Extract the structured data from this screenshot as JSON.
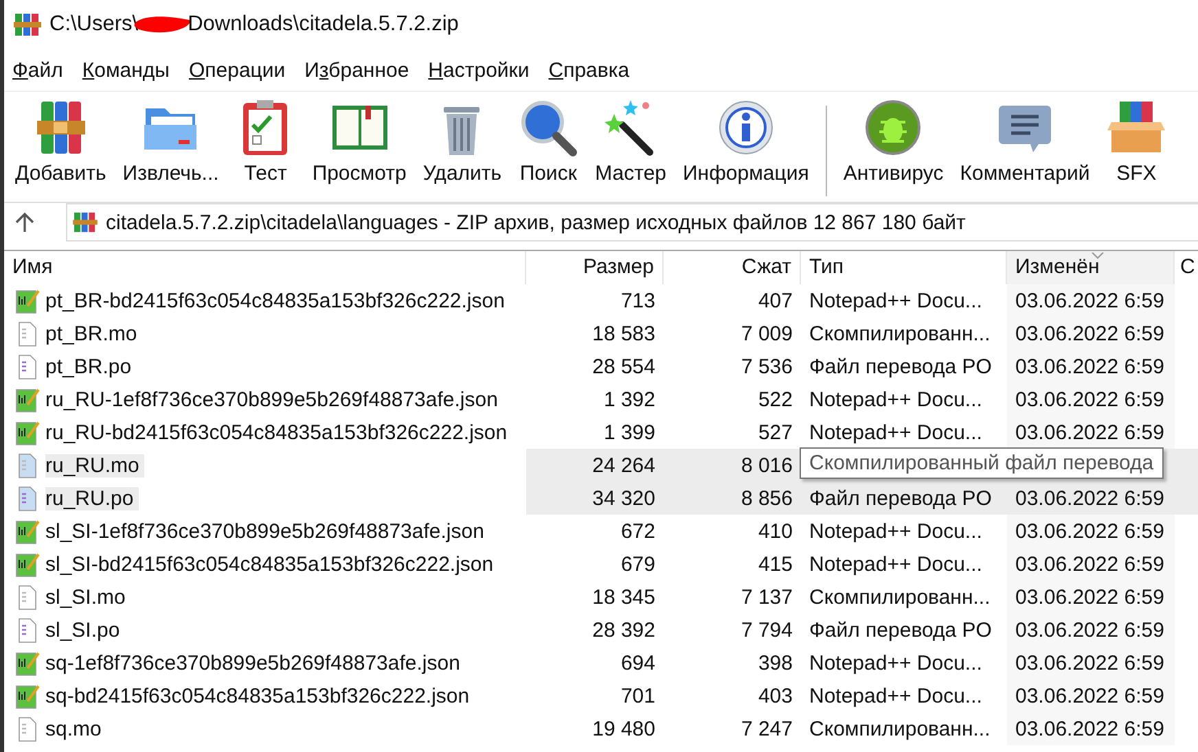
{
  "window": {
    "title_start": "C:\\Users\\",
    "title_end": "Downloads\\citadela.5.7.2.zip"
  },
  "menu": [
    {
      "key": "Ф",
      "rest": "айл"
    },
    {
      "key": "К",
      "rest": "оманды"
    },
    {
      "key": "О",
      "rest": "перации"
    },
    {
      "lead": "И",
      "key": "з",
      "rest": "бранное"
    },
    {
      "key": "Н",
      "rest": "астройки"
    },
    {
      "key": "С",
      "rest": "правка"
    }
  ],
  "toolbar": [
    {
      "label": "Добавить",
      "kind": "add"
    },
    {
      "label": "Извлечь...",
      "kind": "extract"
    },
    {
      "label": "Тест",
      "kind": "test"
    },
    {
      "label": "Просмотр",
      "kind": "view"
    },
    {
      "label": "Удалить",
      "kind": "delete"
    },
    {
      "label": "Поиск",
      "kind": "find"
    },
    {
      "label": "Мастер",
      "kind": "wizard"
    },
    {
      "label": "Информация",
      "kind": "info"
    },
    {
      "label": "Антивирус",
      "kind": "virus",
      "separator_before": true
    },
    {
      "label": "Комментарий",
      "kind": "comment"
    },
    {
      "label": "SFX",
      "kind": "sfx"
    }
  ],
  "address": {
    "value": "citadela.5.7.2.zip\\citadela\\languages - ZIP архив, размер исходных файлов 12 867 180 байт"
  },
  "table": {
    "columns": [
      {
        "label": "Имя",
        "sorted": false
      },
      {
        "label": "Размер",
        "sorted": false
      },
      {
        "label": "Сжат",
        "sorted": false
      },
      {
        "label": "Тип",
        "sorted": false
      },
      {
        "label": "Изменён",
        "sorted": true
      },
      {
        "label": "С",
        "sorted": false
      }
    ],
    "rows": [
      {
        "kind": "json",
        "selected": false,
        "name": "pt_BR-bd2415f63c054c84835a153bf326c222.json",
        "size": "713",
        "packed": "407",
        "type": "Notepad++ Docu...",
        "modified": "03.06.2022 6:59"
      },
      {
        "kind": "mo",
        "selected": false,
        "name": "pt_BR.mo",
        "size": "18 583",
        "packed": "7 009",
        "type": "Скомпилированн...",
        "modified": "03.06.2022 6:59"
      },
      {
        "kind": "po",
        "selected": false,
        "name": "pt_BR.po",
        "size": "28 554",
        "packed": "7 536",
        "type": "Файл перевода PO",
        "modified": "03.06.2022 6:59"
      },
      {
        "kind": "json",
        "selected": false,
        "name": "ru_RU-1ef8f736ce370b899e5b269f48873afe.json",
        "size": "1 392",
        "packed": "522",
        "type": "Notepad++ Docu...",
        "modified": "03.06.2022 6:59"
      },
      {
        "kind": "json",
        "selected": false,
        "name": "ru_RU-bd2415f63c054c84835a153bf326c222.json",
        "size": "1 399",
        "packed": "527",
        "type": "Notepad++ Docu...",
        "modified": "03.06.2022 6:59"
      },
      {
        "kind": "mo",
        "selected": true,
        "name": "ru_RU.mo",
        "size": "24 264",
        "packed": "8 016"
      },
      {
        "kind": "po",
        "selected": true,
        "name": "ru_RU.po",
        "size": "34 320",
        "packed": "8 856",
        "type": "Файл перевода PO",
        "modified": "03.06.2022 6:59"
      },
      {
        "kind": "json",
        "selected": false,
        "name": "sl_SI-1ef8f736ce370b899e5b269f48873afe.json",
        "size": "672",
        "packed": "410",
        "type": "Notepad++ Docu...",
        "modified": "03.06.2022 6:59"
      },
      {
        "kind": "json",
        "selected": false,
        "name": "sl_SI-bd2415f63c054c84835a153bf326c222.json",
        "size": "679",
        "packed": "415",
        "type": "Notepad++ Docu...",
        "modified": "03.06.2022 6:59"
      },
      {
        "kind": "mo",
        "selected": false,
        "name": "sl_SI.mo",
        "size": "18 345",
        "packed": "7 137",
        "type": "Скомпилированн...",
        "modified": "03.06.2022 6:59"
      },
      {
        "kind": "po",
        "selected": false,
        "name": "sl_SI.po",
        "size": "28 392",
        "packed": "7 794",
        "type": "Файл перевода PO",
        "modified": "03.06.2022 6:59"
      },
      {
        "kind": "json",
        "selected": false,
        "name": "sq-1ef8f736ce370b899e5b269f48873afe.json",
        "size": "694",
        "packed": "398",
        "type": "Notepad++ Docu...",
        "modified": "03.06.2022 6:59"
      },
      {
        "kind": "json",
        "selected": false,
        "name": "sq-bd2415f63c054c84835a153bf326c222.json",
        "size": "701",
        "packed": "403",
        "type": "Notepad++ Docu...",
        "modified": "03.06.2022 6:59"
      },
      {
        "kind": "mo",
        "selected": false,
        "name": "sq.mo",
        "size": "19 480",
        "packed": "7 247",
        "type": "Скомпилированн...",
        "modified": "03.06.2022 6:59"
      }
    ]
  },
  "tooltip": {
    "text": "Скомпилированный файл перевода"
  }
}
